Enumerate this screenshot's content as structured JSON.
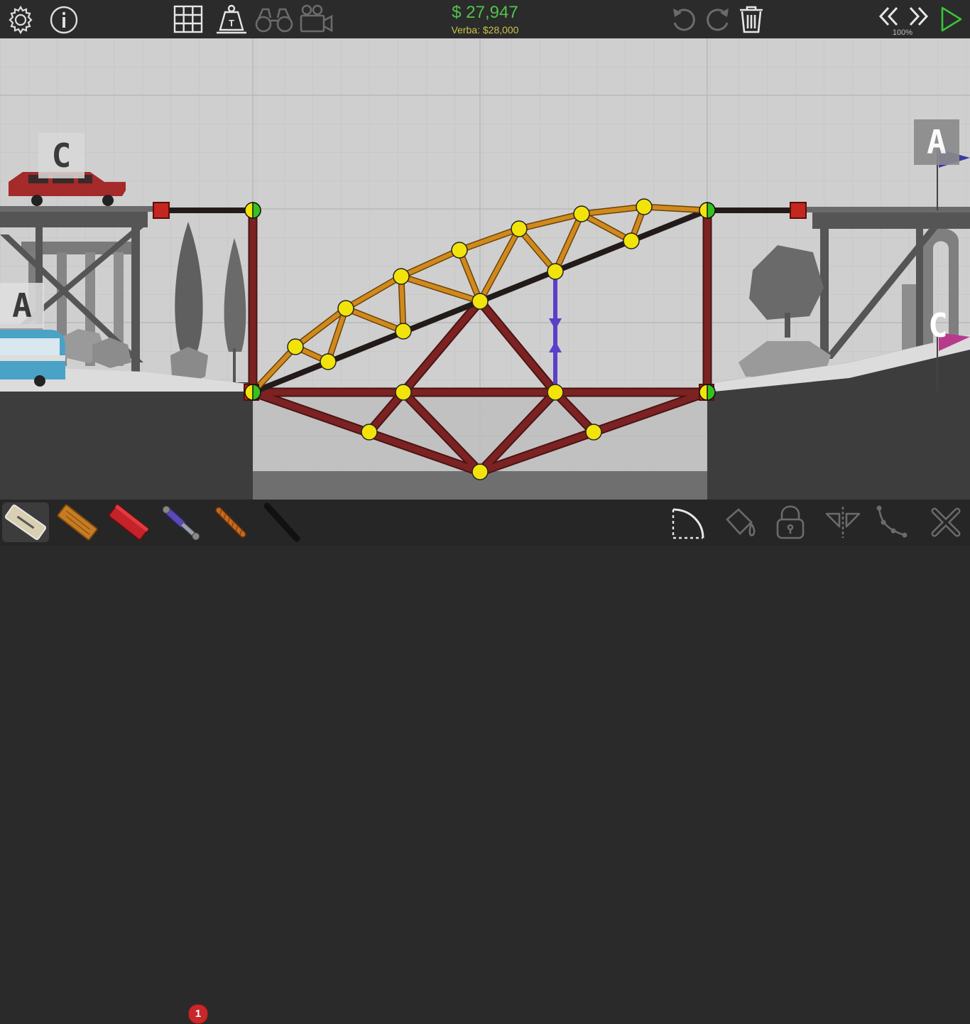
{
  "hud": {
    "money": "$ 27,947",
    "budget": "Verba: $28,000",
    "speed": "100%"
  },
  "colors": {
    "money": "#52c24c",
    "budget": "#c9c24a",
    "road": "#2a1f1f",
    "wood": "#d08a1c",
    "steel": "#7c2222",
    "hydraulic": "#5b3fc9",
    "joint": "#f2e30b",
    "anchor_joint": "#35c21f",
    "fixed_anchor": "#c3271f"
  },
  "toolbar_top": {
    "left": [
      "gear-icon",
      "info-icon"
    ],
    "center": [
      "grid-icon",
      "weight-icon",
      "binoculars-icon",
      "camera-icon"
    ],
    "right": [
      "undo-icon",
      "redo-icon",
      "trash-icon",
      "rewind-icon",
      "fast-forward-icon",
      "play-icon"
    ]
  },
  "materials": [
    {
      "name": "road-material",
      "selected": true
    },
    {
      "name": "wood-material",
      "selected": false
    },
    {
      "name": "steel-material",
      "selected": false
    },
    {
      "name": "hydraulic-material",
      "selected": false,
      "count": "1"
    },
    {
      "name": "rope-material",
      "selected": false
    },
    {
      "name": "spring-material",
      "selected": false
    }
  ],
  "tools_bottom": [
    "arc-tool-icon",
    "paint-bucket-icon",
    "lock-icon",
    "split-icon",
    "trace-path-icon",
    "delete-joint-icon"
  ],
  "flags": {
    "left_top": "C",
    "left_mid": "A",
    "right_top": "A",
    "right_mid": "C"
  }
}
